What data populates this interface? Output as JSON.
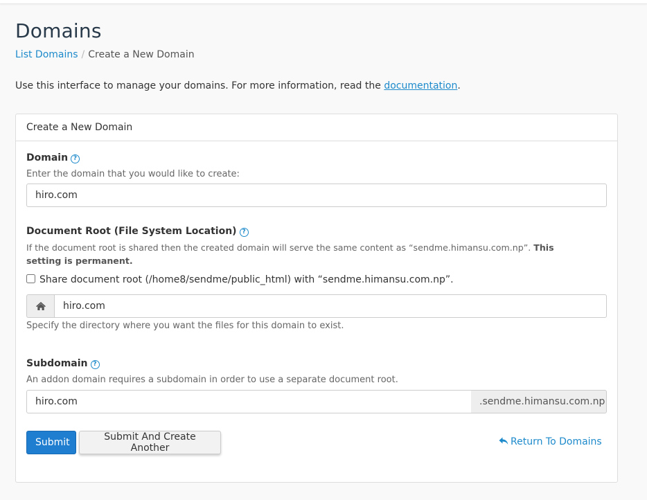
{
  "page": {
    "title": "Domains",
    "breadcrumb": {
      "link": "List Domains",
      "current": "Create a New Domain"
    },
    "intro_text": "Use this interface to manage your domains. For more information, read the ",
    "intro_link": "documentation",
    "intro_end": "."
  },
  "panel": {
    "heading": "Create a New Domain",
    "help_glyph": "?",
    "domain": {
      "label": "Domain",
      "hint": "Enter the domain that you would like to create:",
      "value": "hiro.com"
    },
    "docroot": {
      "label": "Document Root (File System Location)",
      "hint_text": "If the document root is shared then the created domain will serve the same content as “sendme.himansu.com.np”. ",
      "hint_bold": "This setting is permanent.",
      "share_label": "Share document root (/home8/sendme/public_html) with “sendme.himansu.com.np”.",
      "share_checked": false,
      "value": "hiro.com",
      "after_hint": "Specify the directory where you want the files for this domain to exist."
    },
    "subdomain": {
      "label": "Subdomain",
      "hint": "An addon domain requires a subdomain in order to use a separate document root.",
      "value": "hiro.com",
      "suffix": ".sendme.himansu.com.np"
    },
    "actions": {
      "submit": "Submit",
      "submit_another": "Submit And Create Another",
      "return_link": "Return To Domains"
    }
  },
  "colors": {
    "accent": "#1d8acb",
    "primary_button": "#1f7ed0",
    "title": "#293a4a"
  },
  "icons": {
    "home": "home-icon",
    "return": "return-arrow-icon",
    "help": "help-icon"
  }
}
